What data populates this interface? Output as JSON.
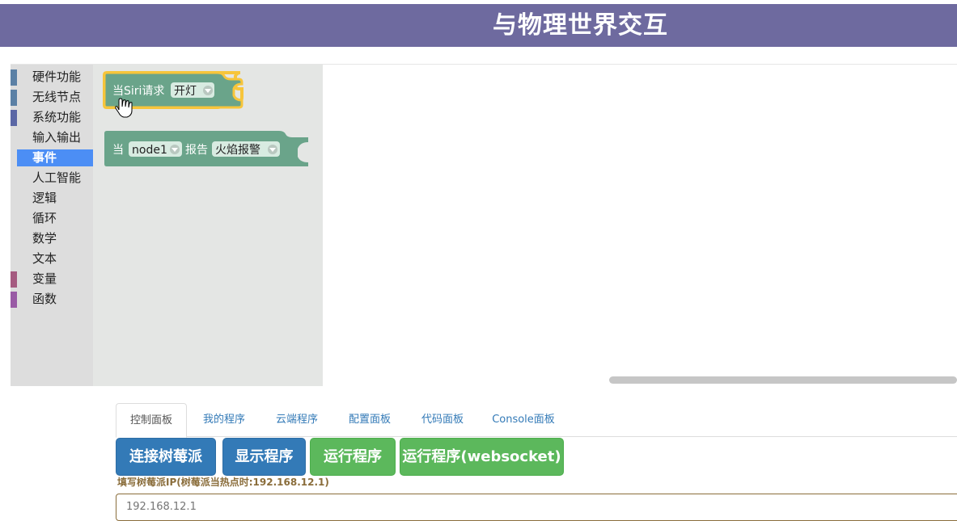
{
  "header": {
    "title": "与物理世界交互",
    "background": "#6e6a9f"
  },
  "toolbox": {
    "categories": [
      {
        "label": "硬件功能",
        "color": "#5b80a5"
      },
      {
        "label": "无线节点",
        "color": "#5b80a5"
      },
      {
        "label": "系统功能",
        "color": "#5b67a5"
      },
      {
        "label": "输入输出",
        "color": ""
      },
      {
        "label": "事件",
        "color": "",
        "selected": true
      },
      {
        "label": "人工智能",
        "color": ""
      },
      {
        "label": "逻辑",
        "color": ""
      },
      {
        "label": "循环",
        "color": ""
      },
      {
        "label": "数学",
        "color": ""
      },
      {
        "label": "文本",
        "color": ""
      },
      {
        "label": "变量",
        "color": "#a55b80"
      },
      {
        "label": "函数",
        "color": "#995ba5"
      }
    ]
  },
  "blocks": {
    "siri_block": {
      "prefix": "当Siri请求",
      "dropdown": "开灯",
      "color": "#6aa48a",
      "highlight": "#f7c53b"
    },
    "node_block": {
      "prefix": "当",
      "node_dropdown": "node1",
      "middle": "报告",
      "event_dropdown": "火焰报警",
      "color": "#6aa48a"
    }
  },
  "tabs": [
    {
      "label": "控制面板",
      "active": true
    },
    {
      "label": "我的程序"
    },
    {
      "label": "云端程序"
    },
    {
      "label": "配置面板"
    },
    {
      "label": "代码面板"
    },
    {
      "label": "Console面板"
    }
  ],
  "buttons": {
    "connect": "连接树莓派",
    "show": "显示程序",
    "run": "运行程序",
    "run_ws": "运行程序(websocket)"
  },
  "ip": {
    "label": "填写树莓派IP(树莓派当热点时:192.168.12.1)",
    "placeholder": "192.168.12.1"
  }
}
